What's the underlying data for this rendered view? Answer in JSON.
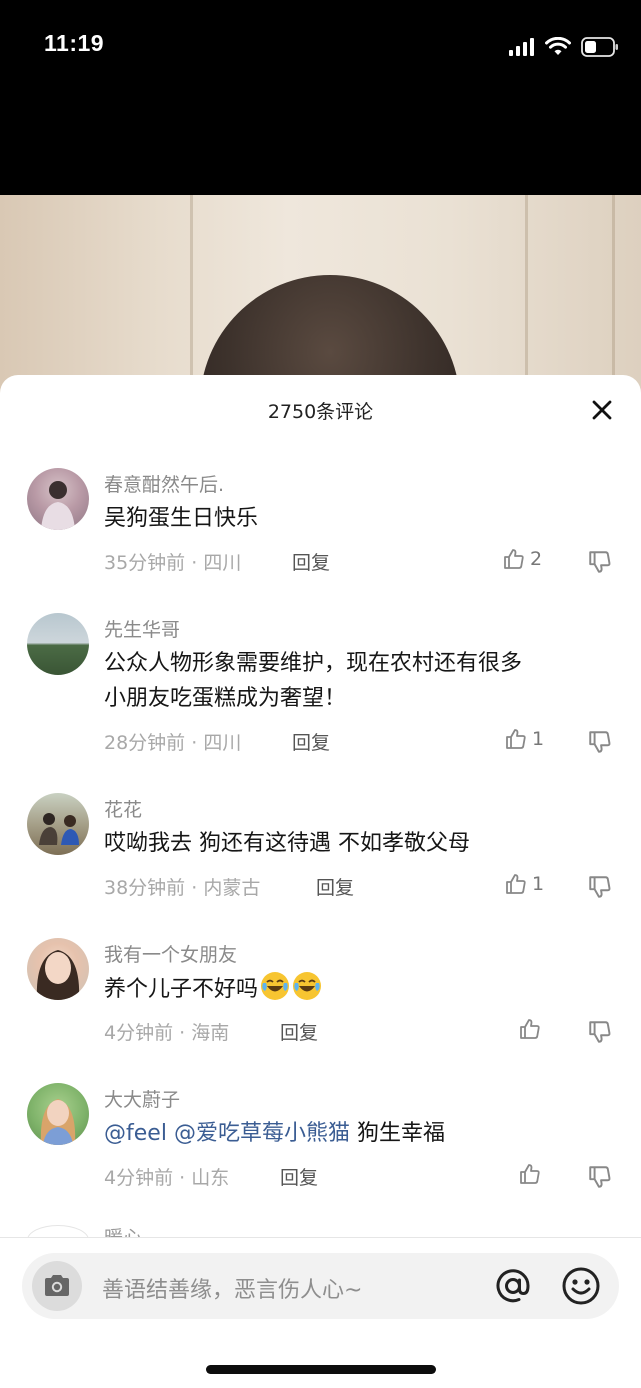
{
  "status": {
    "time": "11:19"
  },
  "sheet": {
    "title": "2750条评论"
  },
  "comments": [
    {
      "user": "春意酣然午后.",
      "text": "吴狗蛋生日快乐",
      "time": "35分钟前",
      "location": "四川",
      "reply_label": "回复",
      "likes": "2"
    },
    {
      "user": "先生华哥",
      "text_line1": "公众人物形象需要维护，现在农村还有很多",
      "text_line2": "小朋友吃蛋糕成为奢望！",
      "time": "28分钟前",
      "location": "四川",
      "reply_label": "回复",
      "likes": "1"
    },
    {
      "user": "花花",
      "text": "哎呦我去 狗还有这待遇 不如孝敬父母",
      "time": "38分钟前",
      "location": "内蒙古",
      "reply_label": "回复",
      "likes": "1"
    },
    {
      "user": "我有一个女朋友",
      "text": "养个儿子不好吗",
      "emoji": "laughing-crying-emoji x2",
      "time": "4分钟前",
      "location": "海南",
      "reply_label": "回复",
      "likes": ""
    },
    {
      "user": "大大蔚子",
      "mention1": "@feel",
      "mention2": "@爱吃草莓小熊猫",
      "text": "狗生幸福",
      "time": "4分钟前",
      "location": "山东",
      "reply_label": "回复",
      "likes": ""
    }
  ],
  "partial_comment": {
    "user": "暖心"
  },
  "input": {
    "placeholder": "善语结善缘，恶言伤人心~"
  },
  "meta": {
    "separator": "·",
    "icons": [
      "signal-icon",
      "wifi-icon",
      "battery-icon",
      "close-icon",
      "thumbs-up-icon",
      "thumbs-down-icon",
      "camera-icon",
      "at-icon",
      "smiley-icon"
    ],
    "colors": {
      "mention": "#3b5d93",
      "meta_text": "#a8a8a8",
      "background": "#ffffff",
      "status_bar": "#000000"
    }
  }
}
